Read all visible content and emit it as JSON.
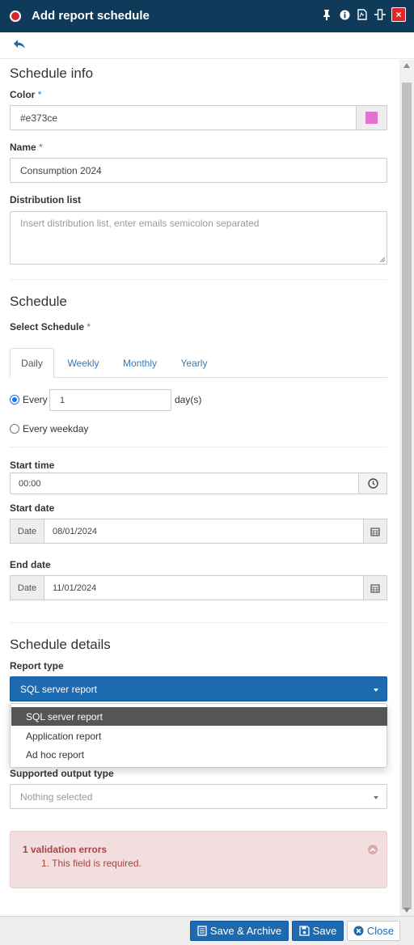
{
  "window": {
    "title": "Add report schedule",
    "close_label": "×"
  },
  "schedule_info": {
    "heading": "Schedule info",
    "color_label": "Color",
    "color_value": "#e373ce",
    "swatch_color": "#e373ce",
    "name_label": "Name",
    "name_value": "Consumption 2024",
    "distribution_label": "Distribution list",
    "distribution_placeholder": "Insert distribution list, enter emails semicolon separated",
    "required_mark": "*"
  },
  "schedule": {
    "heading": "Schedule",
    "select_label": "Select Schedule",
    "tabs": [
      {
        "label": "Daily",
        "active": true
      },
      {
        "label": "Weekly",
        "active": false
      },
      {
        "label": "Monthly",
        "active": false
      },
      {
        "label": "Yearly",
        "active": false
      }
    ],
    "every_label": "Every",
    "every_value": "1",
    "every_unit": "day(s)",
    "weekday_label": "Every weekday",
    "start_time_label": "Start time",
    "start_time_value": "00:00",
    "start_date_label": "Start date",
    "date_addon": "Date",
    "start_date_value": "08/01/2024",
    "end_date_label": "End date",
    "end_date_value": "11/01/2024"
  },
  "schedule_details": {
    "heading": "Schedule details",
    "report_type_label": "Report type",
    "report_type_selected": "SQL server report",
    "report_type_options": [
      "SQL server report",
      "Application report",
      "Ad hoc report"
    ],
    "output_type_label": "Supported output type",
    "output_type_placeholder": "Nothing selected"
  },
  "validation": {
    "title": "1 validation errors",
    "items": [
      "1. This field is required."
    ]
  },
  "footer": {
    "save_archive_label": "Save & Archive",
    "save_label": "Save",
    "close_label": "Close"
  },
  "colors": {
    "titlebar": "#0f3a5a",
    "primary": "#1d6ab1",
    "danger": "#e0262d",
    "alert_bg": "#f2dede",
    "alert_text": "#a94442"
  }
}
